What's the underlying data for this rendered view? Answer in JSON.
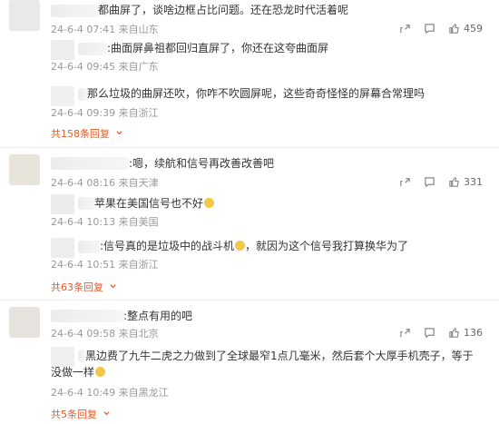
{
  "comments": [
    {
      "text": "都曲屏了，谈啥边框占比问题。还在恐龙时代活着呢",
      "time": "24-6-4 07:41",
      "location": "来自山东",
      "likes": "459",
      "replies": [
        {
          "text": ":曲面屏鼻祖都回归直屏了，你还在这夸曲面屏",
          "time": "24-6-4 09:45",
          "location": "来自广东"
        },
        {
          "text": "那么垃圾的曲屏还吹，你咋不吹圆屏呢，这些奇奇怪怪的屏幕合常理吗",
          "time": "24-6-4 09:39",
          "location": "来自浙江"
        }
      ],
      "more_replies": "共158条回复"
    },
    {
      "text": ":嗯，续航和信号再改善改善吧",
      "time": "24-6-4 08:16",
      "location": "来自天津",
      "likes": "331",
      "replies": [
        {
          "text": "苹果在美国信号也不好",
          "time": "24-6-4 10:13",
          "location": "来自美国"
        },
        {
          "text": ":信号真的是垃圾中的战斗机",
          "text_after": "，就因为这个信号我打算换华为了",
          "time": "24-6-4 10:51",
          "location": "来自浙江"
        }
      ],
      "more_replies": "共63条回复"
    },
    {
      "text": ":整点有用的吧",
      "time": "24-6-4 09:58",
      "location": "来自北京",
      "likes": "136",
      "replies": [
        {
          "text": "黑边费了九牛二虎之力做到了全球最窄1点几毫米，然后套个大厚手机壳子，等于",
          "text_line2": "没做一样",
          "time": "24-6-4 10:49",
          "location": "来自黑龙江"
        }
      ],
      "more_replies": "共5条回复"
    }
  ],
  "icons": {
    "share": "share-icon",
    "comment": "comment-icon",
    "like": "thumbs-up-icon",
    "more": "chevron-down-icon"
  },
  "colors": {
    "more_link": "#e65a2b",
    "meta": "#999999",
    "text": "#333333"
  }
}
